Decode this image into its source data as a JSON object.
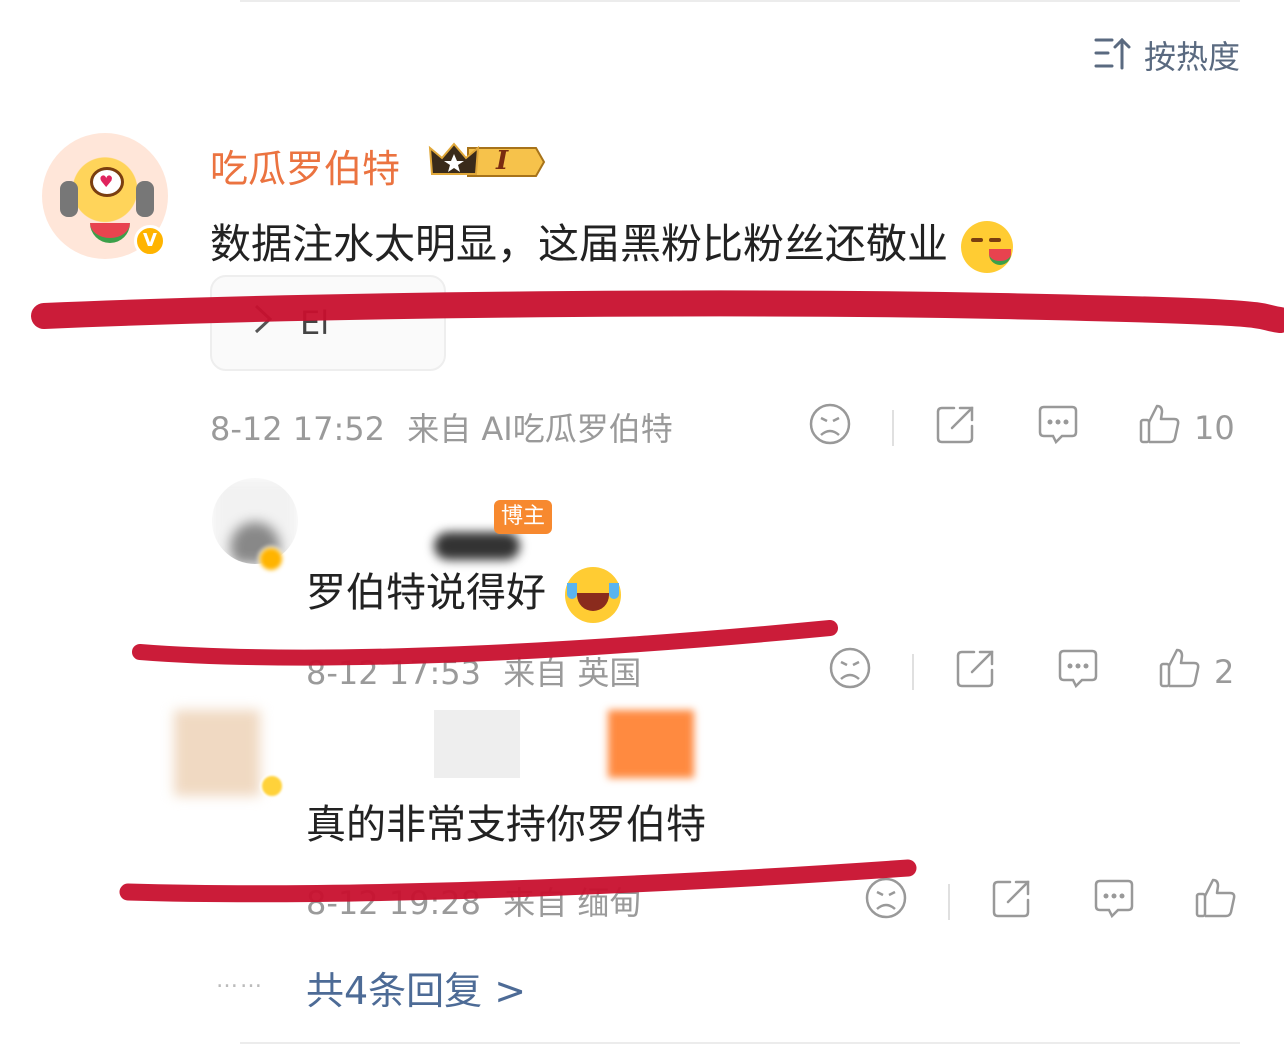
{
  "sort": {
    "label": "按热度",
    "icon": "sort-icon"
  },
  "main_comment": {
    "username": "吃瓜罗伯特",
    "level_badge": "I",
    "verified_badge": "V",
    "text": "数据注水太明显，这届黑粉比粉丝还敬业",
    "emoji": "eating-watermelon-emoji",
    "link_card_text": "El",
    "timestamp": "8-12 17:52",
    "source": "来自 AI吃瓜罗伯特",
    "likes": "10"
  },
  "replies": [
    {
      "badge": "博主",
      "text": "罗伯特说得好",
      "emoji": "laugh-cry-emoji",
      "timestamp": "8-12 17:53",
      "source": "来自 英国",
      "likes": "2"
    },
    {
      "text": "真的非常支持你罗伯特",
      "timestamp": "8-12 19:28",
      "source": "来自 缅甸",
      "likes": ""
    }
  ],
  "footer": {
    "dots": "……",
    "more_label": "共4条回复 >"
  },
  "colors": {
    "username": "#eb7340",
    "link": "#4d6b96",
    "meta": "#9a9a9a",
    "scribble": "#c8102e",
    "blogger_tag": "#f7892f"
  }
}
